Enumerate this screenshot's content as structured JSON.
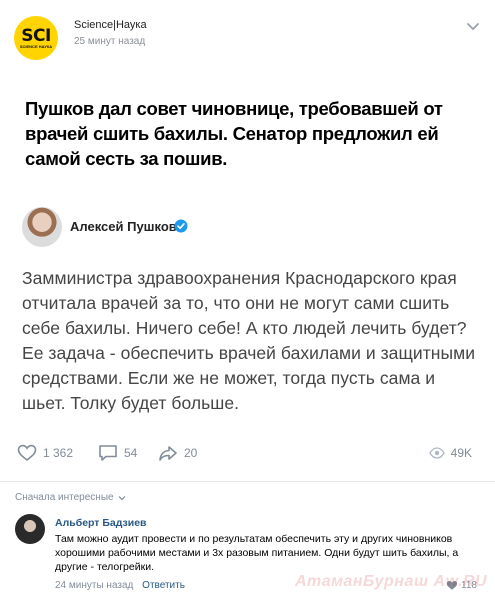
{
  "post": {
    "author": "Science|Наука",
    "time": "25 минут назад",
    "avatar_text": "SCI",
    "avatar_subtext": "SCIENCE НАУКА"
  },
  "headline": "Пушков дал совет чиновнице, требовавшей от врачей сшить бахилы. Сенатор предложил ей самой сесть за пошив.",
  "tweet": {
    "author": "Алексей Пушков",
    "text": "Замминистра здравоохранения Краснодарского края отчитала врачей за то, что они не могут сами сшить себе бахилы. Ничего себе! А кто людей лечить будет? Ее задача - обеспечить врачей бахилами и защитными средствами. Если же не может, тогда пусть сама и шьет. Толку будет больше."
  },
  "actions": {
    "likes": "1 362",
    "comments": "54",
    "shares": "20",
    "views": "49K"
  },
  "comments_sort": "Сначала интересные",
  "comment": {
    "author": "Альберт Бадзиев",
    "text": "Там можно аудит провести и по результатам обеспечить эту и других чиновников хорошими рабочими местами и 3х разовым питанием. Одни будут шить бахилы, а другие - телогрейки.",
    "time": "24 минуты назад",
    "reply": "Ответить",
    "likes": "118"
  },
  "watermark": "АтаманБурнаш Aw.RU",
  "colors": {
    "accent_yellow": "#ffd400",
    "link_blue": "#2a5885",
    "muted_gray": "#818c99",
    "verified_blue": "#1d9bf0"
  }
}
